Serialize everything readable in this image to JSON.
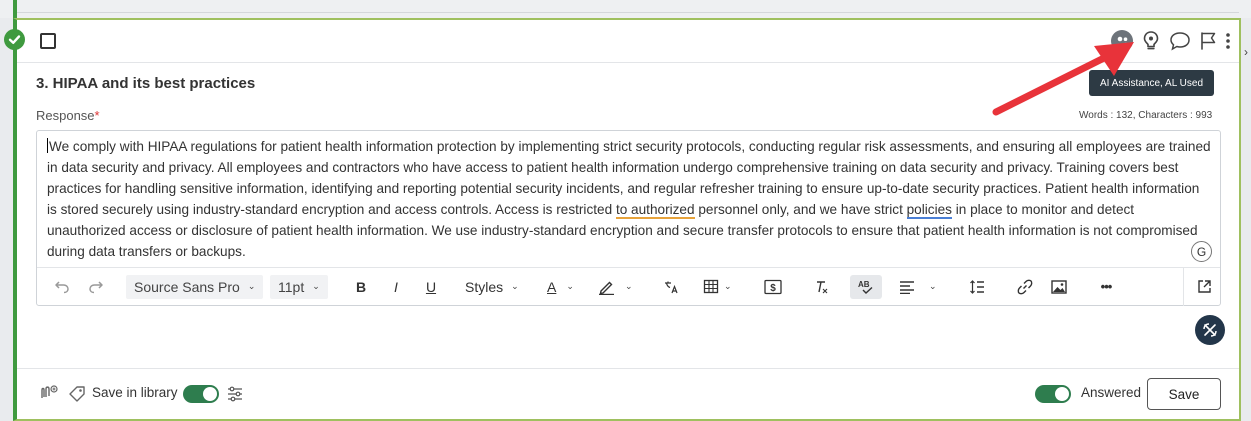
{
  "question": {
    "title": "3. HIPAA and its best practices",
    "response_label": "Response",
    "required_mark": "*",
    "counter": "Words : 132, Characters : 993",
    "tooltip": "AI Assistance, AL Used"
  },
  "response": {
    "part1": "We comply with HIPAA regulations for patient health information protection by implementing strict security protocols, conducting regular risk assessments, and ensuring all employees are trained in data security and privacy. All employees and contractors who have access to patient health information undergo comprehensive training on data security and privacy. Training covers best practices for handling sensitive information, identifying and reporting potential security incidents, and regular refresher training to ensure up-to-date security practices. Patient health information is stored securely using industry-standard encryption and access controls. Access is restricted ",
    "flag_orange": "to authorized",
    "part2": " personnel only, and we have strict ",
    "flag_blue": "policies",
    "part3": " in place to monitor and detect unauthorized access or disclosure of patient health information. We use industry-standard encryption and secure transfer protocols to ensure that patient health information is not compromised during data transfers or backups."
  },
  "grammar_badge": "G",
  "toolbar": {
    "font_family": "Source Sans Pro",
    "font_size": "11pt",
    "bold": "B",
    "italic": "I",
    "underline": "U",
    "styles": "Styles",
    "font_color": "A",
    "more": "•••"
  },
  "footer": {
    "save_in_library": "Save in library",
    "answered": "Answered",
    "save": "Save",
    "save_in_library_on": true,
    "answered_on": true
  },
  "colors": {
    "accent_green": "#3f9a3f",
    "toggle_on": "#2e7d4e",
    "card_border": "#9fc05f",
    "annotation_arrow": "#e8333a",
    "tooltip_bg": "#2d3a44"
  },
  "icons": [
    "check-circle-icon",
    "checkbox-icon",
    "collaborators-icon",
    "ai-assistance-icon",
    "comment-icon",
    "flag-icon",
    "kebab-menu-icon",
    "undo-icon",
    "redo-icon",
    "highlight-icon",
    "translate-icon",
    "table-icon",
    "currency-icon",
    "clear-format-icon",
    "spellcheck-icon",
    "align-icon",
    "line-spacing-icon",
    "link-icon",
    "image-icon",
    "expand-icon",
    "ai-assist-fab-icon",
    "attachment-icon",
    "tag-icon",
    "settings-sliders-icon"
  ]
}
